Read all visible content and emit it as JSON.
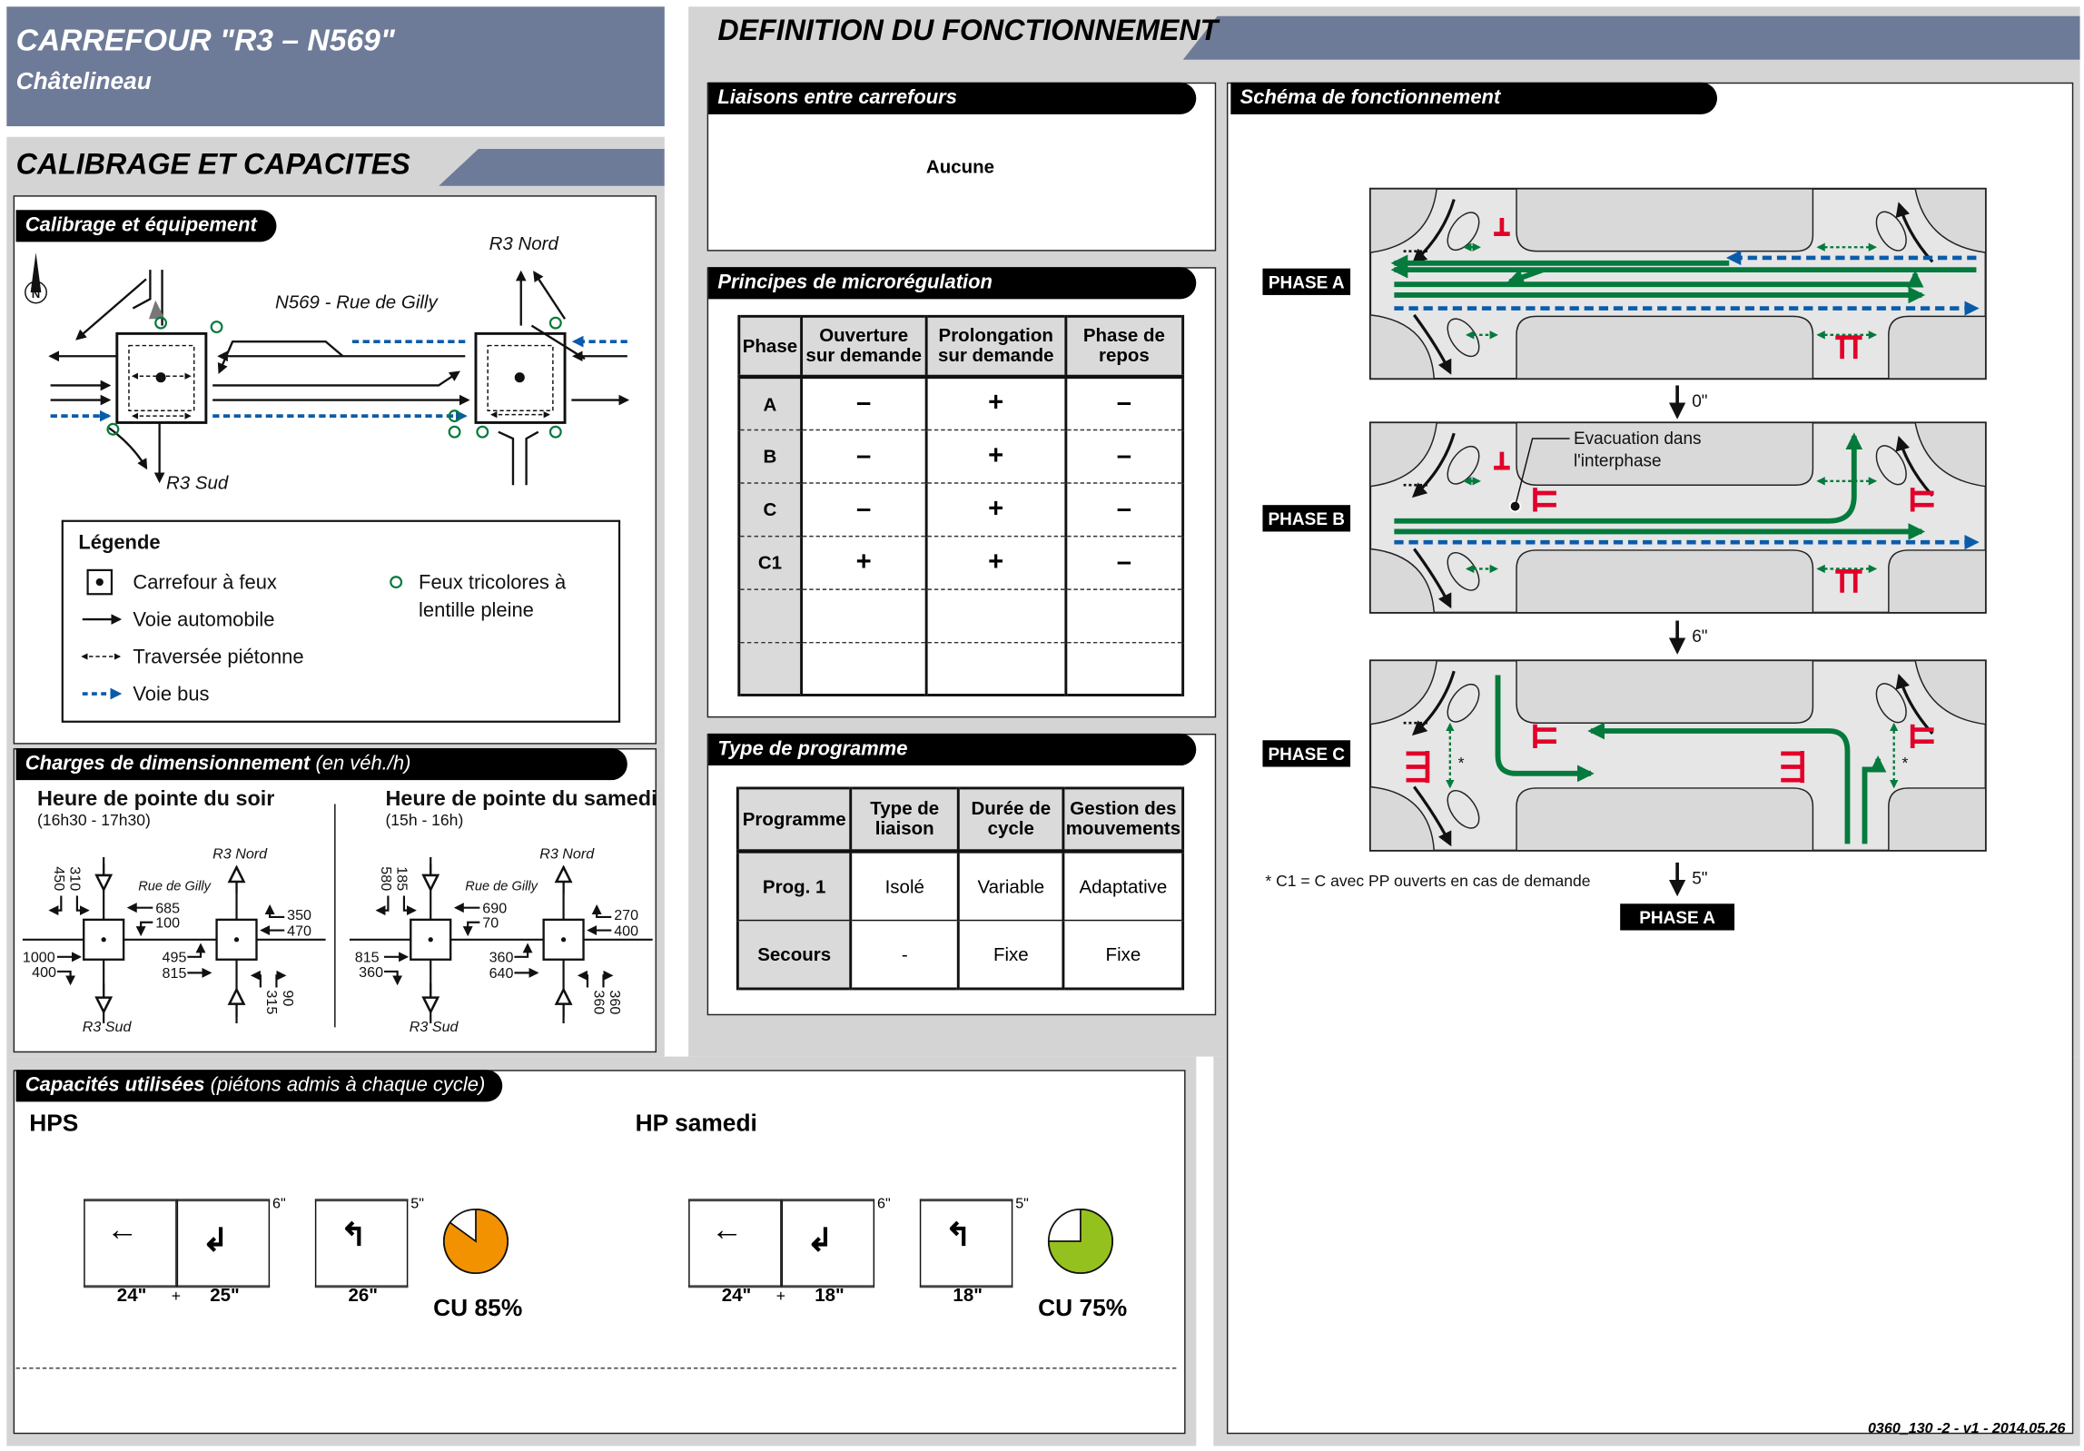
{
  "title": {
    "main": "CARREFOUR \"R3 – N569\"",
    "sub": "Châtelineau"
  },
  "colors": {
    "title_bg": "#6e7b98",
    "green": "#047a3c",
    "blue": "#0a5caa",
    "red": "#e2002a",
    "orange": "#f39200",
    "lime": "#95c11f"
  },
  "left": {
    "header": "CALIBRAGE ET CAPACITES",
    "calibrage": {
      "tab": "Calibrage et équipement",
      "north": "N",
      "r3_nord": "R3 Nord",
      "r3_sud": "R3 Sud",
      "n569": "N569 - Rue de Gilly",
      "legend": {
        "title": "Légende",
        "items": [
          "Carrefour à feux",
          "Voie automobile",
          "Traversée piétonne",
          "Voie bus"
        ],
        "feux_1": "Feux tricolores à",
        "feux_2": "lentille pleine"
      }
    },
    "charges": {
      "tab": "Charges de dimensionnement",
      "tab_unit": "(en véh./h)",
      "periods": [
        {
          "title": "Heure de pointe du soir",
          "time": "(16h30 - 17h30)",
          "r3_nord": "R3 Nord",
          "r3_sud": "R3 Sud",
          "street": "Rue de Gilly",
          "north_left": "450",
          "north_right": "310",
          "w1_through": "685",
          "w1_left": "100",
          "w2_right": "350",
          "w2_through": "470",
          "e1_through": "1000",
          "e1_right": "400",
          "e2_left": "495",
          "e2_through": "815",
          "s_left": "315",
          "s_right": "90"
        },
        {
          "title": "Heure de pointe du samedi",
          "time": "(15h - 16h)",
          "r3_nord": "R3 Nord",
          "r3_sud": "R3 Sud",
          "street": "Rue de Gilly",
          "north_left": "580",
          "north_right": "185",
          "w1_through": "690",
          "w1_left": "70",
          "w2_right": "270",
          "w2_through": "400",
          "e1_through": "815",
          "e1_right": "360",
          "e2_left": "360",
          "e2_through": "640",
          "s_left": "360",
          "s_right": "360"
        }
      ]
    },
    "capacites": {
      "tab": "Capacités utilisées",
      "tab_note": "(piétons admis à chaque cycle)",
      "groups": [
        {
          "title": "HPS",
          "t1": "24\"",
          "plus": "+",
          "t2": "25\"",
          "inter1": "6\"",
          "t3": "26\"",
          "inter2": "5\"",
          "cu_label": "CU 85%",
          "cu": 85,
          "color": "#f39200"
        },
        {
          "title": "HP samedi",
          "t1": "24\"",
          "plus": "+",
          "t2": "18\"",
          "inter1": "6\"",
          "t3": "18\"",
          "inter2": "5\"",
          "cu_label": "CU 75%",
          "cu": 75,
          "color": "#95c11f"
        }
      ]
    }
  },
  "right": {
    "header": "DEFINITION DU FONCTIONNEMENT",
    "liaisons": {
      "tab": "Liaisons entre carrefours",
      "value": "Aucune"
    },
    "principes": {
      "tab": "Principes de microrégulation",
      "headers": [
        "Phase",
        "Ouverture sur demande",
        "Prolongation sur demande",
        "Phase de repos"
      ],
      "rows": [
        [
          "A",
          "–",
          "+",
          "–"
        ],
        [
          "B",
          "–",
          "+",
          "–"
        ],
        [
          "C",
          "–",
          "+",
          "–"
        ],
        [
          "C1",
          "+",
          "+",
          "–"
        ],
        [
          "",
          "",
          "",
          ""
        ],
        [
          "",
          "",
          "",
          ""
        ]
      ]
    },
    "programme": {
      "tab": "Type de programme",
      "headers": [
        "Programme",
        "Type de liaison",
        "Durée de cycle",
        "Gestion des mouvements"
      ],
      "rows": [
        [
          "Prog. 1",
          "Isolé",
          "Variable",
          "Adaptative"
        ],
        [
          "Secours",
          "-",
          "Fixe",
          "Fixe"
        ]
      ]
    },
    "schema": {
      "tab": "Schéma de fonctionnement",
      "phases": [
        "PHASE A",
        "PHASE B",
        "PHASE C"
      ],
      "transitions": [
        "0\"",
        "6\"",
        "5\""
      ],
      "back_to": "PHASE A",
      "evacuation_1": "Evacuation dans",
      "evacuation_2": "l'interphase",
      "star": "*",
      "footnote": "* C1 = C avec PP ouverts en cas de demande"
    }
  },
  "footer": "0360_130 -2 - v1 - 2014.05.26"
}
